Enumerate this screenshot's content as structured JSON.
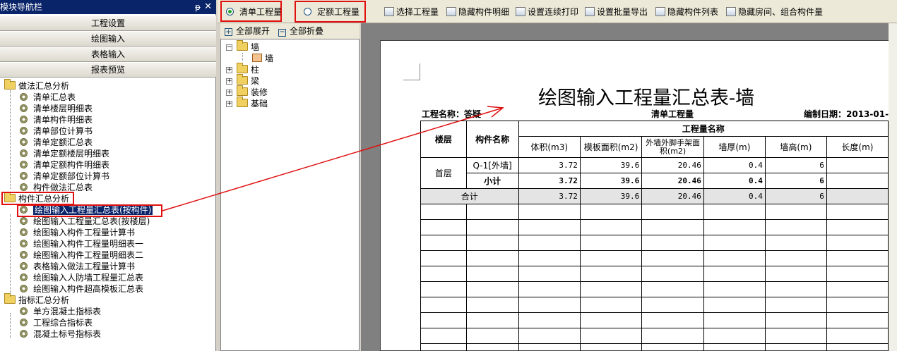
{
  "nav": {
    "title": "模块导航栏",
    "pin": "ᵽ",
    "close": "✕",
    "buttons": [
      "工程设置",
      "绘图输入",
      "表格输入",
      "报表预览"
    ],
    "groups": [
      {
        "label": "做法汇总分析",
        "items": [
          "清单汇总表",
          "清单楼层明细表",
          "清单构件明细表",
          "清单部位计算书",
          "清单定额汇总表",
          "清单定额楼层明细表",
          "清单定额构件明细表",
          "清单定额部位计算书",
          "构件做法汇总表"
        ]
      },
      {
        "label": "构件汇总分析",
        "items": [
          "绘图输入工程量汇总表(按构件)",
          "绘图输入工程量汇总表(按楼层)",
          "绘图输入构件工程量计算书",
          "绘图输入构件工程量明细表一",
          "绘图输入构件工程量明细表二",
          "表格输入做法工程量计算书",
          "绘图输入人防墙工程量汇总表",
          "绘图输入构件超高模板汇总表"
        ]
      },
      {
        "label": "指标汇总分析",
        "items": [
          "单方混凝土指标表",
          "工程综合指标表",
          "混凝土标号指标表"
        ]
      }
    ]
  },
  "toolbar": {
    "radio1": "清单工程量",
    "radio2": "定额工程量",
    "buttons": [
      "选择工程量",
      "隐藏构件明细",
      "设置连续打印",
      "设置批量导出",
      "隐藏构件列表",
      "隐藏房间、组合构件量"
    ]
  },
  "mid": {
    "expand": "全部展开",
    "collapse": "全部折叠",
    "tree": [
      {
        "label": "墙",
        "child": "墙"
      },
      {
        "label": "柱"
      },
      {
        "label": "梁"
      },
      {
        "label": "装修"
      },
      {
        "label": "基础"
      }
    ]
  },
  "report": {
    "title": "绘图输入工程量汇总表-墙",
    "project_label": "工程名称：答疑",
    "type_label": "清单工程量",
    "date_label": "编制日期：2013-01-",
    "headers": {
      "floor": "楼层",
      "component": "构件名称",
      "group": "工程量名称",
      "cols": [
        "体积(m3)",
        "模板面积(m2)",
        "外墙外脚手架面积(m2)",
        "墙厚(m)",
        "墙高(m)",
        "长度(m)"
      ]
    },
    "rows": [
      {
        "floor": "首层",
        "name": "Q-1[外墙]",
        "values": [
          "3.72",
          "39.6",
          "20.46",
          "0.4",
          "6",
          ""
        ]
      },
      {
        "floor": "",
        "name": "小计",
        "values": [
          "3.72",
          "39.6",
          "20.46",
          "0.4",
          "6",
          ""
        ]
      }
    ],
    "total": {
      "label": "合计",
      "values": [
        "3.72",
        "39.6",
        "20.46",
        "0.4",
        "6",
        ""
      ]
    }
  },
  "colors": {
    "highlight": "#e01010",
    "selection": "#0a246a"
  }
}
